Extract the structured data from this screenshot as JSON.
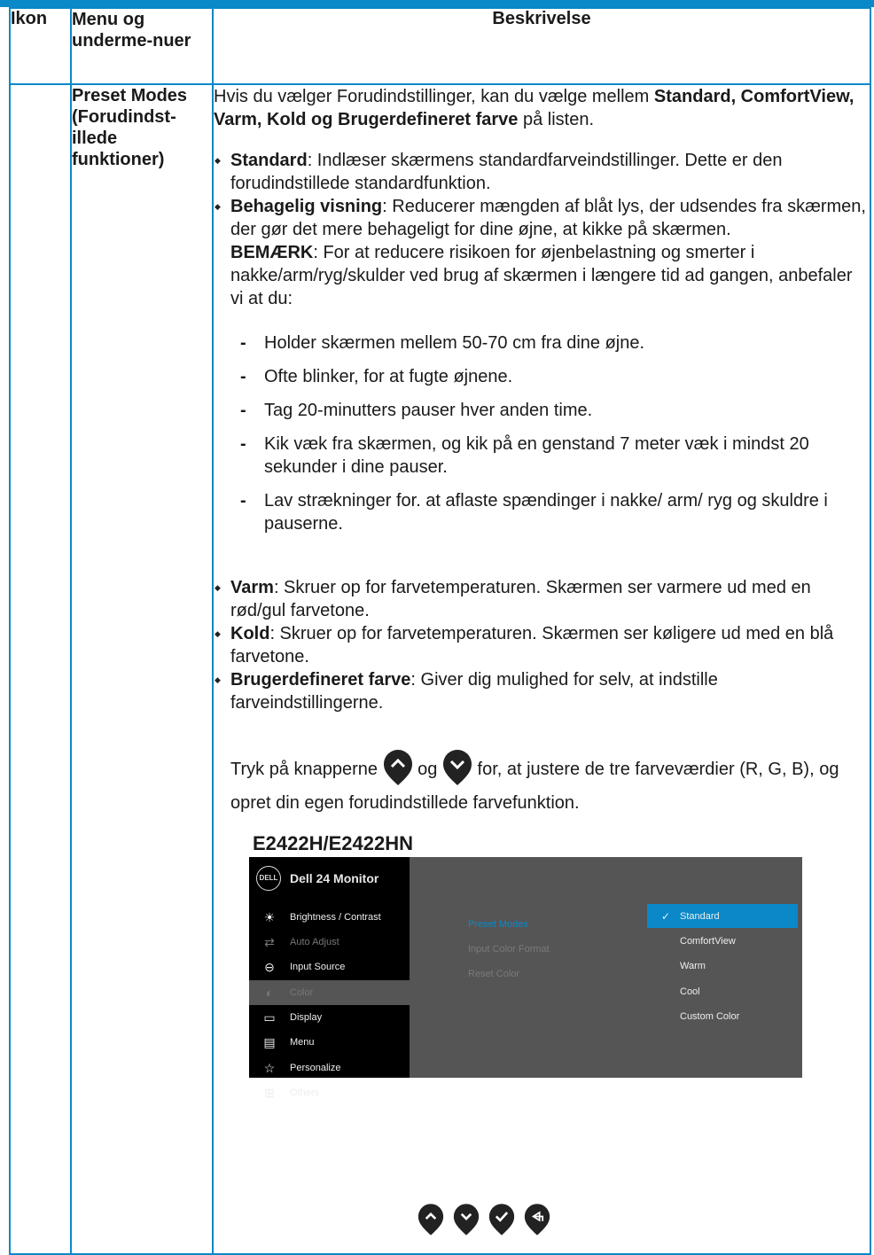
{
  "table": {
    "headers": {
      "ikon": "Ikon",
      "menu": "Menu og underme-nuer",
      "beskrivelse": "Beskrivelse"
    },
    "menu_cell": "Preset Modes (Forudindst-illede funktioner)",
    "intro_prefix": "Hvis du vælger Forudindstillinger, kan du vælge mellem ",
    "intro_bold": "Standard, ComfortView, Varm, Kold og Brugerdefineret farve",
    "intro_suffix": " på listen.",
    "bullets1": [
      {
        "term": "Standard",
        "text": ": Indlæser skærmens standardfarveindstillinger. Dette er den forudindstillede standardfunktion."
      },
      {
        "term": "Behagelig visning",
        "text": ": Reducerer mængden af blåt lys, der udsendes fra skærmen, der gør det mere behageligt for dine øjne, at kikke på skærmen."
      }
    ],
    "note_term": "BEMÆRK",
    "note_text": ": For at reducere risikoen for øjenbelastning og smerter i nakke/arm/ryg/skulder ved brug af skærmen i længere tid ad gangen, anbefaler vi at du:",
    "dash_items": [
      "Holder skærmen mellem 50-70 cm fra dine øjne.",
      "Ofte blinker, for at fugte øjnene.",
      "Tag 20-minutters pauser hver anden time.",
      "Kik væk fra skærmen, og kik på en genstand 7 meter væk i mindst 20 sekunder i dine pauser.",
      "Lav strækninger for. at aflaste spændinger i nakke/ arm/ ryg og skuldre i pauserne."
    ],
    "bullets2": [
      {
        "term": "Varm",
        "text": ": Skruer op for farvetemperaturen. Skærmen ser varmere ud med en rød/gul farvetone."
      },
      {
        "term": "Kold",
        "text": ": Skruer op for farvetemperaturen. Skærmen ser køligere ud med en blå farvetone."
      },
      {
        "term": "Brugerdefineret farve",
        "text": ": Giver dig mulighed for selv, at indstille farveindstillingerne."
      }
    ],
    "press_a": "Tryk på knapperne",
    "press_b": "og",
    "press_c": "for, at justere de tre farveværdier (R, G, B), og opret din egen forudindstillede farvefunktion.",
    "model": "E2422H/E2422HN"
  },
  "osd": {
    "logo": "DELL",
    "title": "Dell 24 Monitor",
    "menu": [
      {
        "label": "Brightness / Contrast",
        "icon": "sun-icon",
        "glyph": "☀",
        "state": "normal"
      },
      {
        "label": "Auto Adjust",
        "icon": "auto-adjust-icon",
        "glyph": "⇄",
        "state": "dim"
      },
      {
        "label": "Input Source",
        "icon": "input-icon",
        "glyph": "⊖",
        "state": "normal"
      },
      {
        "label": "Color",
        "icon": "color-drop-icon",
        "glyph": "◐",
        "state": "active"
      },
      {
        "label": "Display",
        "icon": "display-icon",
        "glyph": "▭",
        "state": "normal"
      },
      {
        "label": "Menu",
        "icon": "menu-icon",
        "glyph": "▤",
        "state": "normal"
      },
      {
        "label": "Personalize",
        "icon": "star-icon",
        "glyph": "☆",
        "state": "normal"
      },
      {
        "label": "Others",
        "icon": "others-icon",
        "glyph": "⊞",
        "state": "normal"
      }
    ],
    "submenu": [
      "Preset Modes",
      "Input Color Format",
      "Reset Color"
    ],
    "options": [
      "Standard",
      "ComfortView",
      "Warm",
      "Cool",
      "Custom Color"
    ],
    "selected_option": "Standard",
    "colors": {
      "accent": "#0a88c8",
      "osd_bg": "#555555",
      "osd_menu_bg": "#000000"
    }
  },
  "nav_buttons": [
    "up-icon",
    "down-icon",
    "check-icon",
    "back-icon"
  ]
}
